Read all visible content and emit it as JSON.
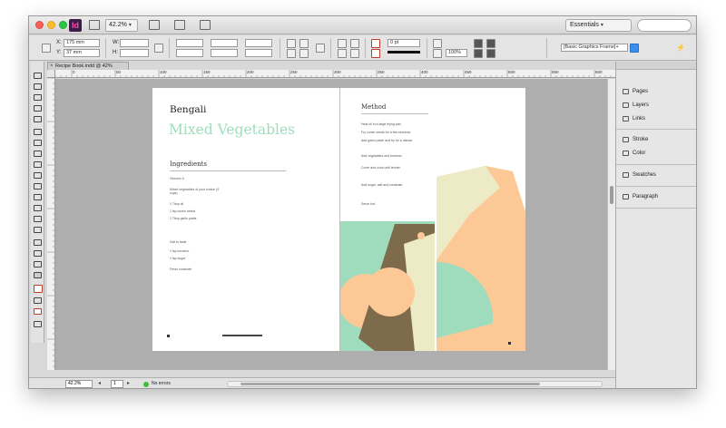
{
  "app": {
    "logo": "Id",
    "zoom": "42.2%",
    "workspace": "Essentials"
  },
  "control_panel": {
    "x_label": "X:",
    "x_value": "175 mm",
    "y_label": "Y:",
    "y_value": "37 mm",
    "w_label": "W:",
    "h_label": "H:",
    "stroke_weight": "0 pt",
    "opacity": "100%",
    "frame_style": "[Basic Graphics Frame]+"
  },
  "document": {
    "tab_label": "Recipe Book.indd @ 42%",
    "page_field": "1"
  },
  "ruler": {
    "h_numbers": [
      "0",
      "50",
      "100",
      "150",
      "200",
      "250",
      "300",
      "350",
      "400",
      "450",
      "500",
      "550",
      "600"
    ]
  },
  "left_page": {
    "heading": "Bengali",
    "title": "Mixed Vegetables",
    "section": "Ingredients",
    "serves": "Serves 4",
    "ingredients": [
      "Mixed vegetables of your choice (4 cups)",
      "1 Tbsp oil",
      "1 tsp cumin seeds",
      "1 Tbsp garlic paste",
      "Salt to taste",
      "1 tsp turmeric",
      "1 tsp sugar",
      "Fresh coriander"
    ]
  },
  "right_page": {
    "section": "Method",
    "steps": [
      "Heat oil in a large frying pan.",
      "Fry cumin seeds for a few seconds.",
      "Add garlic paste and fry for a minute.",
      "Add vegetables and turmeric.",
      "Cover and cook until tender.",
      "Add sugar, salt and coriander.",
      "Serve hot."
    ]
  },
  "panels": {
    "items": [
      "Pages",
      "Layers",
      "Links",
      "Stroke",
      "Color",
      "Swatches",
      "Paragraph"
    ]
  },
  "status": {
    "zoom": "42.2%",
    "errors": "No errors"
  },
  "colors": {
    "mint": "#9fdcbd",
    "peach": "#fcc996",
    "olive": "#7e6b4c",
    "cream": "#ecebc6"
  }
}
